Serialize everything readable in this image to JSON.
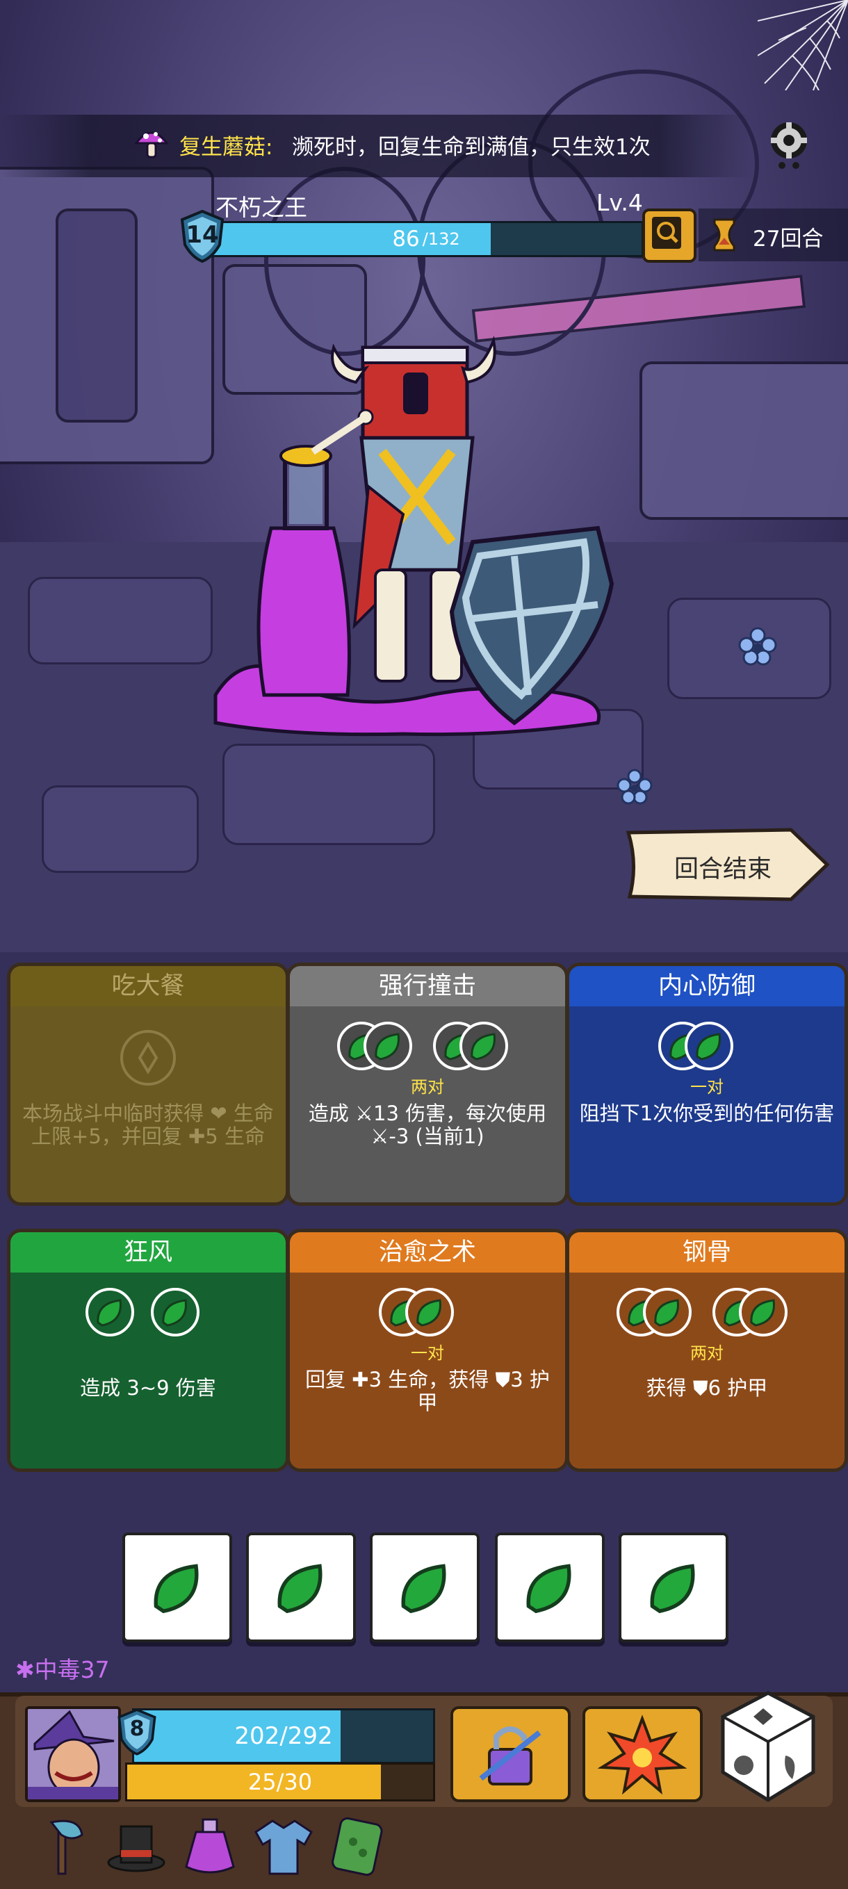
{
  "buff": {
    "name": "复生蘑菇",
    "colon": ":",
    "description": "濒死时，回复生命到满值，只生效1次",
    "icon": "mushroom-icon"
  },
  "enemy": {
    "name": "不朽之王",
    "level": "Lv.4",
    "shield_value": "14",
    "hp_current": "86",
    "hp_max": "/132",
    "hp_fraction": 0.65,
    "rounds": "27回合"
  },
  "end_turn": {
    "label": "回合结束"
  },
  "cards": [
    {
      "title": "吃大餐",
      "sub": "",
      "desc": "本场战斗中临时获得 ❤ 生命上限+5，并回复 ✚5 生命",
      "color": "olive"
    },
    {
      "title": "强行撞击",
      "sub": "两对",
      "desc": "造成 ⚔13 伤害，每次使用 ⚔-3 (当前1)",
      "color": "gray"
    },
    {
      "title": "内心防御",
      "sub": "一对",
      "desc": "阻挡下1次你受到的任何伤害",
      "color": "blue"
    },
    {
      "title": "狂风",
      "sub": "",
      "desc": "造成 3~9 伤害",
      "color": "green"
    },
    {
      "title": "治愈之术",
      "sub": "一对",
      "desc": "回复 ✚3 生命，获得 ⛊3 护甲",
      "color": "orange"
    },
    {
      "title": "钢骨",
      "sub": "两对",
      "desc": "获得 ⛊6 护甲",
      "color": "orange"
    }
  ],
  "dice": [
    "wind",
    "wind",
    "wind",
    "wind",
    "wind"
  ],
  "status": {
    "label": "中毒",
    "value": "37",
    "text": "✱中毒37"
  },
  "player": {
    "shield_value": "8",
    "hp_text": "202/292",
    "hp_fraction": 0.69,
    "energy_text": "25/30",
    "energy_fraction": 0.83
  },
  "equipment": [
    "axe-icon",
    "top-hat-icon",
    "potion-icon",
    "shirt-icon",
    "leaf-scroll-icon"
  ]
}
